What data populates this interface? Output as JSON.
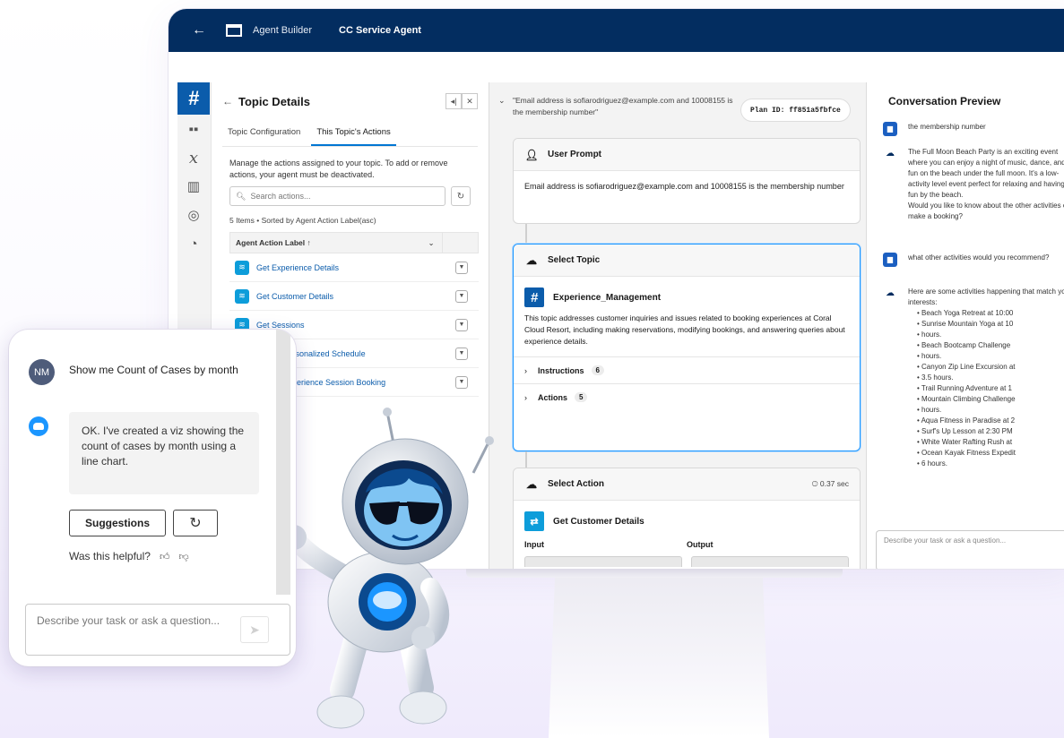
{
  "header": {
    "back_icon": "arrow-left-icon",
    "app_name": "Agent Builder",
    "agent_name": "CC Service Agent"
  },
  "topic_panel": {
    "title": "Topic Details",
    "tabs": [
      "Topic Configuration",
      "This Topic's Actions"
    ],
    "description": "Manage the actions assigned to your topic. To add or remove actions, your agent must be deactivated.",
    "search_placeholder": "Search actions...",
    "items_count": "5 Items • Sorted by Agent Action Label(asc)",
    "column_header": "Agent Action Label ↑",
    "actions": [
      "Get Experience Details",
      "Get Customer Details",
      "Get Sessions",
      "Create Personalized Schedule",
      "Create Experience Session Booking"
    ]
  },
  "flow": {
    "query": "\"Email address is sofiarodriguez@example.com and 10008155 is the membership number\"",
    "plan_id": "Plan ID: ff851a5fbfce",
    "user_prompt": {
      "title": "User Prompt",
      "text": "Email address is sofiarodriguez@example.com and 10008155 is the membership number"
    },
    "select_topic": {
      "title": "Select Topic",
      "topic_name": "Experience_Management",
      "topic_desc": "This topic addresses customer inquiries and issues related to booking experiences at Coral Cloud Resort, including making reservations, modifying bookings, and answering queries about experience details.",
      "instructions_label": "Instructions",
      "instructions_count": "6",
      "actions_label": "Actions",
      "actions_count": "5"
    },
    "select_action": {
      "title": "Select Action",
      "time": "0.37 sec",
      "action_name": "Get Customer Details",
      "input_label": "Input",
      "output_label": "Output"
    }
  },
  "conversation": {
    "title": "Conversation Preview",
    "msg0": "the membership number",
    "msg1": "The Full Moon Beach Party is an exciting event where you can enjoy a night of music, dance, and fun on the beach under the full moon. It's a low-activity level event perfect for relaxing and having fun by the beach.",
    "msg1b": "Would you like to know about the other activities or make a booking?",
    "msg2": "what other activities would you recommend?",
    "msg3": "Here are some activities happening that match your interests:",
    "activities": [
      "Beach Yoga Retreat at 10:00",
      "Sunrise Mountain Yoga at 10",
      "hours.",
      "Beach Bootcamp Challenge",
      "hours.",
      "Canyon Zip Line Excursion at",
      "3.5 hours.",
      "Trail Running Adventure at 1",
      "Mountain Climbing Challenge",
      "hours.",
      "Aqua Fitness in Paradise at 2",
      "Surf's Up Lesson at 2:30 PM",
      "White Water Rafting Rush at",
      "Ocean Kayak Fitness Expedit",
      "6 hours."
    ],
    "input_placeholder": "Describe your task or ask a question..."
  },
  "widget": {
    "user_initials": "NM",
    "user_message": "Show me Count of Cases by month",
    "bot_message": "OK. I've created a viz showing the count of cases by month using a line chart.",
    "suggestions_label": "Suggestions",
    "helpful_label": "Was this helpful?",
    "input_placeholder": "Describe your task or ask a question..."
  },
  "colors": {
    "nav_bg": "#032d60",
    "brand_blue": "#0b5cab",
    "accent_blue": "#1b96ff",
    "action_icon": "#0d9dda"
  }
}
